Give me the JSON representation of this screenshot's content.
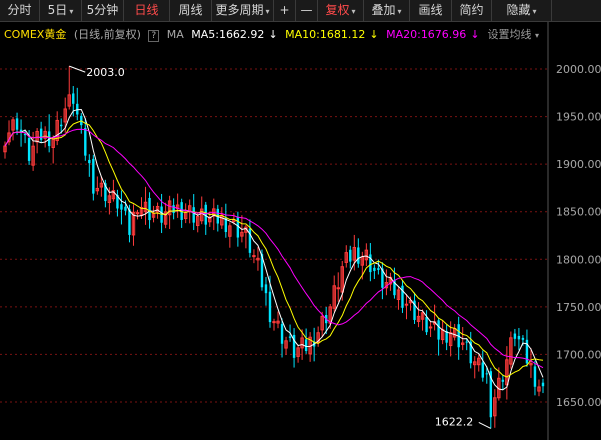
{
  "toolbar": {
    "items": [
      {
        "label": "分时",
        "w": 40
      },
      {
        "label": "5日",
        "w": 42,
        "caret": true
      },
      {
        "label": "5分钟",
        "w": 42
      },
      {
        "label": "日线",
        "w": 46,
        "active": true
      },
      {
        "label": "周线",
        "w": 42
      },
      {
        "label": "更多周期",
        "w": 62,
        "caret": true
      },
      {
        "label": "+",
        "w": 22
      },
      {
        "label": "—",
        "w": 22
      },
      {
        "label": "复权",
        "w": 46,
        "caret": true,
        "active": true
      },
      {
        "label": "叠加",
        "w": 46,
        "caret": true
      },
      {
        "label": "画线",
        "w": 42
      },
      {
        "label": "简约",
        "w": 40
      },
      {
        "label": "隐藏",
        "w": 60,
        "caret": true
      }
    ]
  },
  "indicator_bar": {
    "symbol": "COMEX黄金",
    "mode": "(日线,前复权)",
    "help": "?",
    "ma_label": "MA",
    "ma5": "MA5:1662.92",
    "ma10": "MA10:1681.12",
    "ma20": "MA20:1676.96",
    "arrow": "↓",
    "settings": "设置均线",
    "settings_caret": "▾"
  },
  "colors": {
    "up": "#ff3b3b",
    "down": "#00e5ff",
    "ma5": "#ffffff",
    "ma10": "#ffff00",
    "ma20": "#ff00ff",
    "grid": "#7a1212",
    "axis_text": "#a8a8a8",
    "symbol": "#ffe000"
  },
  "chart_data": {
    "type": "candlestick",
    "y_ticks": [
      "2000.00",
      "1950.00",
      "1900.00",
      "1850.00",
      "1800.00",
      "1750.00",
      "1700.00",
      "1650.00"
    ],
    "ylim": [
      1622,
      2003
    ],
    "annotations": {
      "high": "2003.0",
      "low": "1622.2"
    },
    "close_anchors": [
      [
        0,
        1930
      ],
      [
        3,
        1945
      ],
      [
        6,
        1910
      ],
      [
        9,
        1930
      ],
      [
        12,
        1930
      ],
      [
        15,
        1958
      ],
      [
        17,
        1970
      ],
      [
        19,
        1930
      ],
      [
        22,
        1880
      ],
      [
        25,
        1870
      ],
      [
        28,
        1860
      ],
      [
        31,
        1830
      ],
      [
        33,
        1860
      ],
      [
        36,
        1850
      ],
      [
        39,
        1845
      ],
      [
        42,
        1853
      ],
      [
        45,
        1852
      ],
      [
        48,
        1845
      ],
      [
        51,
        1842
      ],
      [
        54,
        1842
      ],
      [
        57,
        1835
      ],
      [
        60,
        1825
      ],
      [
        63,
        1790
      ],
      [
        66,
        1745
      ],
      [
        69,
        1720
      ],
      [
        72,
        1703
      ],
      [
        75,
        1708
      ],
      [
        78,
        1725
      ],
      [
        81,
        1750
      ],
      [
        84,
        1790
      ],
      [
        87,
        1808
      ],
      [
        90,
        1803
      ],
      [
        93,
        1780
      ],
      [
        96,
        1770
      ],
      [
        99,
        1760
      ],
      [
        102,
        1745
      ],
      [
        105,
        1730
      ],
      [
        108,
        1720
      ],
      [
        111,
        1725
      ],
      [
        114,
        1712
      ],
      [
        117,
        1690
      ],
      [
        120,
        1675
      ],
      [
        121,
        1645
      ],
      [
        124,
        1680
      ],
      [
        127,
        1723
      ],
      [
        130,
        1695
      ],
      [
        133,
        1668
      ],
      [
        134,
        1660
      ]
    ],
    "wick_up": [
      8,
      22,
      5,
      10,
      18,
      7,
      14,
      25,
      6,
      12,
      9,
      30,
      4,
      16,
      11,
      20,
      8,
      13,
      28,
      5,
      17,
      10,
      7,
      21,
      12,
      6,
      15,
      19,
      9,
      24,
      11,
      8,
      14,
      5,
      18,
      27,
      10,
      13,
      7,
      22,
      16,
      9,
      12,
      20,
      6,
      15,
      11,
      23
    ],
    "wick_down": [
      12,
      6,
      18,
      9,
      25,
      14,
      7,
      10,
      20,
      5,
      16,
      11,
      28,
      8,
      13,
      19,
      6,
      22,
      10,
      15,
      9,
      24,
      12,
      7,
      17,
      11,
      21,
      5,
      14,
      26,
      8,
      13,
      19,
      10,
      6,
      23,
      15,
      9,
      12,
      18,
      7,
      25,
      11,
      16,
      14,
      8,
      20,
      13
    ],
    "body_pct": [
      0.3,
      0.45,
      0.2,
      0.55,
      0.35,
      0.6,
      0.25,
      0.5,
      0.4,
      0.65,
      0.3,
      0.15,
      0.5,
      0.45,
      0.35,
      0.55,
      0.2,
      0.6,
      0.4,
      0.3,
      0.5,
      0.25,
      0.45,
      0.35,
      0.55,
      0.4,
      0.2,
      0.6,
      0.3,
      0.5,
      0.45,
      0.35,
      0.25,
      0.55,
      0.4,
      0.3,
      0.6,
      0.2,
      0.5,
      0.35,
      0.45,
      0.25,
      0.55,
      0.3,
      0.4,
      0.5,
      0.2,
      0.35
    ]
  }
}
